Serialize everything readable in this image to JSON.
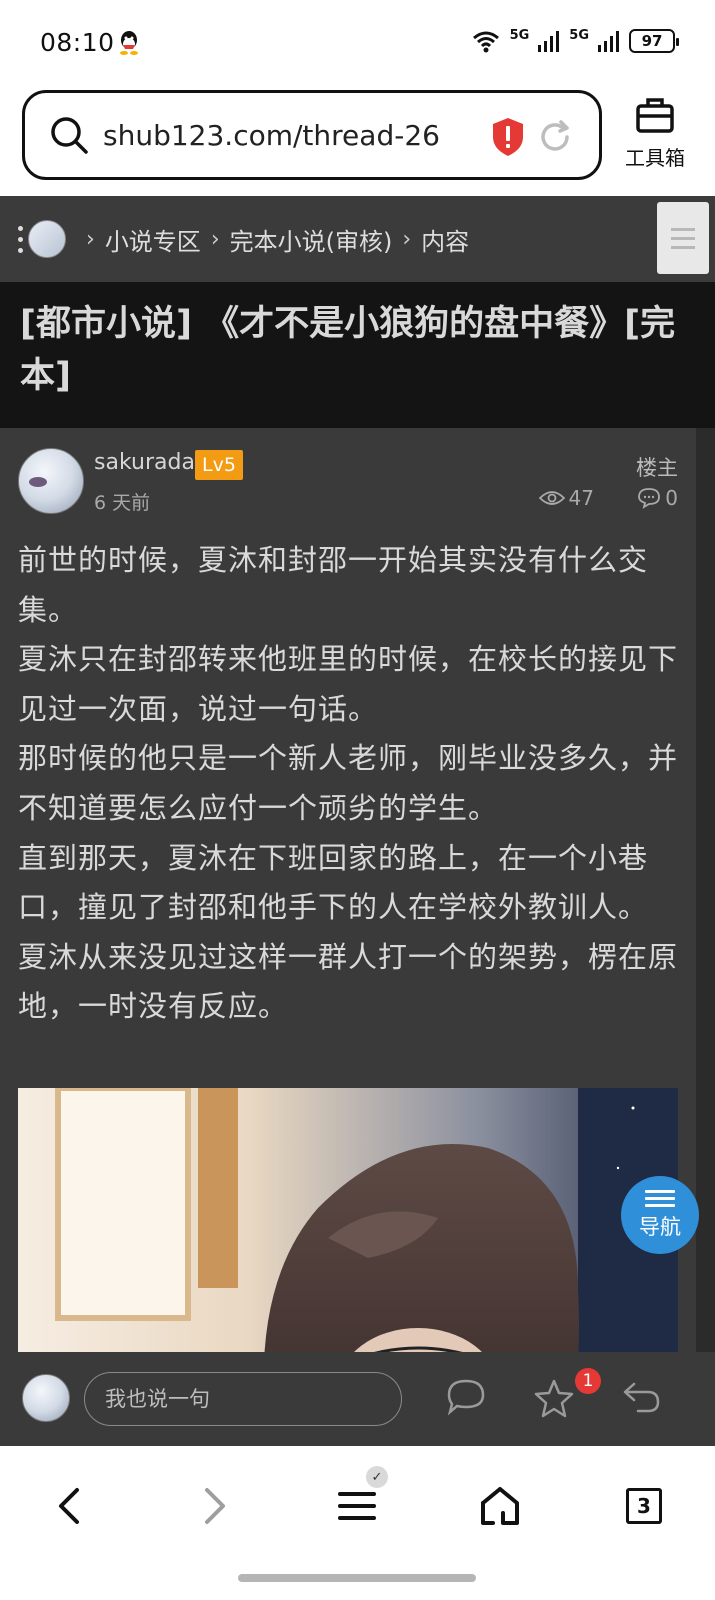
{
  "status_bar": {
    "time": "08:10",
    "network_1": "5G",
    "network_2": "5G",
    "battery": "97"
  },
  "browser": {
    "url": "shub123.com/thread-26...",
    "toolbox_label": "工具箱",
    "tabs_count": "3"
  },
  "breadcrumb": {
    "items": [
      "小说专区",
      "完本小说(审核)",
      "内容"
    ],
    "separator": "›"
  },
  "thread": {
    "title": "[都市小说] 《才不是小狼狗的盘中餐》[完本]"
  },
  "post": {
    "username": "sakurada",
    "level": "Lv5",
    "time": "6 天前",
    "role": "楼主",
    "views": "47",
    "replies": "0",
    "paragraphs": [
      "前世的时候，夏沐和封邵一开始其实没有什么交集。",
      "夏沐只在封邵转来他班里的时候，在校长的接见下见过一次面，说过一句话。",
      "那时候的他只是一个新人老师，刚毕业没多久，并不知道要怎么应付一个顽劣的学生。",
      "直到那天，夏沐在下班回家的路上，在一个小巷口，撞见了封邵和他手下的人在学校外教训人。",
      "夏沐从来没见过这样一群人打一个的架势，楞在原地，一时没有反应。"
    ]
  },
  "nav_button": {
    "label": "导航"
  },
  "reply_bar": {
    "placeholder": "我也说一句",
    "favorite_badge": "1"
  },
  "colors": {
    "page_bg": "#2b2b2b",
    "post_bg": "#3a3a3a",
    "level_badge": "#f39b12",
    "nav_button": "#2f8fd8",
    "notification_badge": "#e53935",
    "shield": "#e53935"
  },
  "icons": {
    "search": "search-icon",
    "shield": "shield-icon",
    "reload": "reload-icon",
    "toolbox": "toolbox-icon",
    "eye": "eye-icon",
    "comment": "comment-icon",
    "star": "star-icon",
    "reply": "reply-icon",
    "back": "back-icon",
    "forward": "forward-icon",
    "menu": "menu-icon",
    "home": "home-icon"
  }
}
